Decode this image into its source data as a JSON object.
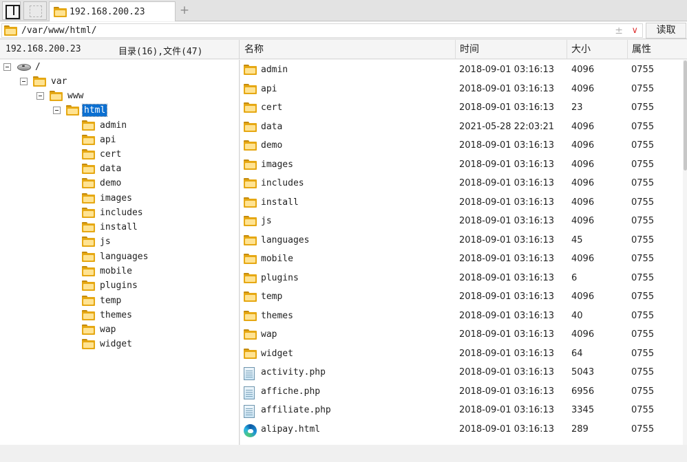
{
  "tabs": {
    "active_label": "192.168.200.23"
  },
  "pathbar": {
    "path": "/var/www/html/",
    "read_button": "读取",
    "sync_glyph": "±",
    "dropdown_glyph": "∨"
  },
  "left_header": {
    "host": "192.168.200.23",
    "summary": "目录(16),文件(47)"
  },
  "columns": {
    "name": "名称",
    "time": "时间",
    "size": "大小",
    "attr": "属性"
  },
  "tree": {
    "root": "/",
    "var": "var",
    "www": "www",
    "html": "html",
    "children": [
      "admin",
      "api",
      "cert",
      "data",
      "demo",
      "images",
      "includes",
      "install",
      "js",
      "languages",
      "mobile",
      "plugins",
      "temp",
      "themes",
      "wap",
      "widget"
    ]
  },
  "files": [
    {
      "name": "admin",
      "time": "2018-09-01 03:16:13",
      "size": "4096",
      "attr": "0755",
      "icon": "folder-icon"
    },
    {
      "name": "api",
      "time": "2018-09-01 03:16:13",
      "size": "4096",
      "attr": "0755",
      "icon": "folder-icon"
    },
    {
      "name": "cert",
      "time": "2018-09-01 03:16:13",
      "size": "23",
      "attr": "0755",
      "icon": "folder-icon"
    },
    {
      "name": "data",
      "time": "2021-05-28 22:03:21",
      "size": "4096",
      "attr": "0755",
      "icon": "folder-icon"
    },
    {
      "name": "demo",
      "time": "2018-09-01 03:16:13",
      "size": "4096",
      "attr": "0755",
      "icon": "folder-icon"
    },
    {
      "name": "images",
      "time": "2018-09-01 03:16:13",
      "size": "4096",
      "attr": "0755",
      "icon": "folder-icon"
    },
    {
      "name": "includes",
      "time": "2018-09-01 03:16:13",
      "size": "4096",
      "attr": "0755",
      "icon": "folder-icon"
    },
    {
      "name": "install",
      "time": "2018-09-01 03:16:13",
      "size": "4096",
      "attr": "0755",
      "icon": "folder-icon"
    },
    {
      "name": "js",
      "time": "2018-09-01 03:16:13",
      "size": "4096",
      "attr": "0755",
      "icon": "folder-icon"
    },
    {
      "name": "languages",
      "time": "2018-09-01 03:16:13",
      "size": "45",
      "attr": "0755",
      "icon": "folder-icon"
    },
    {
      "name": "mobile",
      "time": "2018-09-01 03:16:13",
      "size": "4096",
      "attr": "0755",
      "icon": "folder-icon"
    },
    {
      "name": "plugins",
      "time": "2018-09-01 03:16:13",
      "size": "6",
      "attr": "0755",
      "icon": "folder-icon"
    },
    {
      "name": "temp",
      "time": "2018-09-01 03:16:13",
      "size": "4096",
      "attr": "0755",
      "icon": "folder-icon"
    },
    {
      "name": "themes",
      "time": "2018-09-01 03:16:13",
      "size": "40",
      "attr": "0755",
      "icon": "folder-icon"
    },
    {
      "name": "wap",
      "time": "2018-09-01 03:16:13",
      "size": "4096",
      "attr": "0755",
      "icon": "folder-icon"
    },
    {
      "name": "widget",
      "time": "2018-09-01 03:16:13",
      "size": "64",
      "attr": "0755",
      "icon": "folder-icon"
    },
    {
      "name": "activity.php",
      "time": "2018-09-01 03:16:13",
      "size": "5043",
      "attr": "0755",
      "icon": "php-file-icon"
    },
    {
      "name": "affiche.php",
      "time": "2018-09-01 03:16:13",
      "size": "6956",
      "attr": "0755",
      "icon": "php-file-icon"
    },
    {
      "name": "affiliate.php",
      "time": "2018-09-01 03:16:13",
      "size": "3345",
      "attr": "0755",
      "icon": "php-file-icon"
    },
    {
      "name": "alipay.html",
      "time": "2018-09-01 03:16:13",
      "size": "289",
      "attr": "0755",
      "icon": "edge-html-icon"
    }
  ],
  "colors": {
    "selection": "#0b6fd1",
    "folder": "#e6a813",
    "accent_red": "#d33"
  }
}
